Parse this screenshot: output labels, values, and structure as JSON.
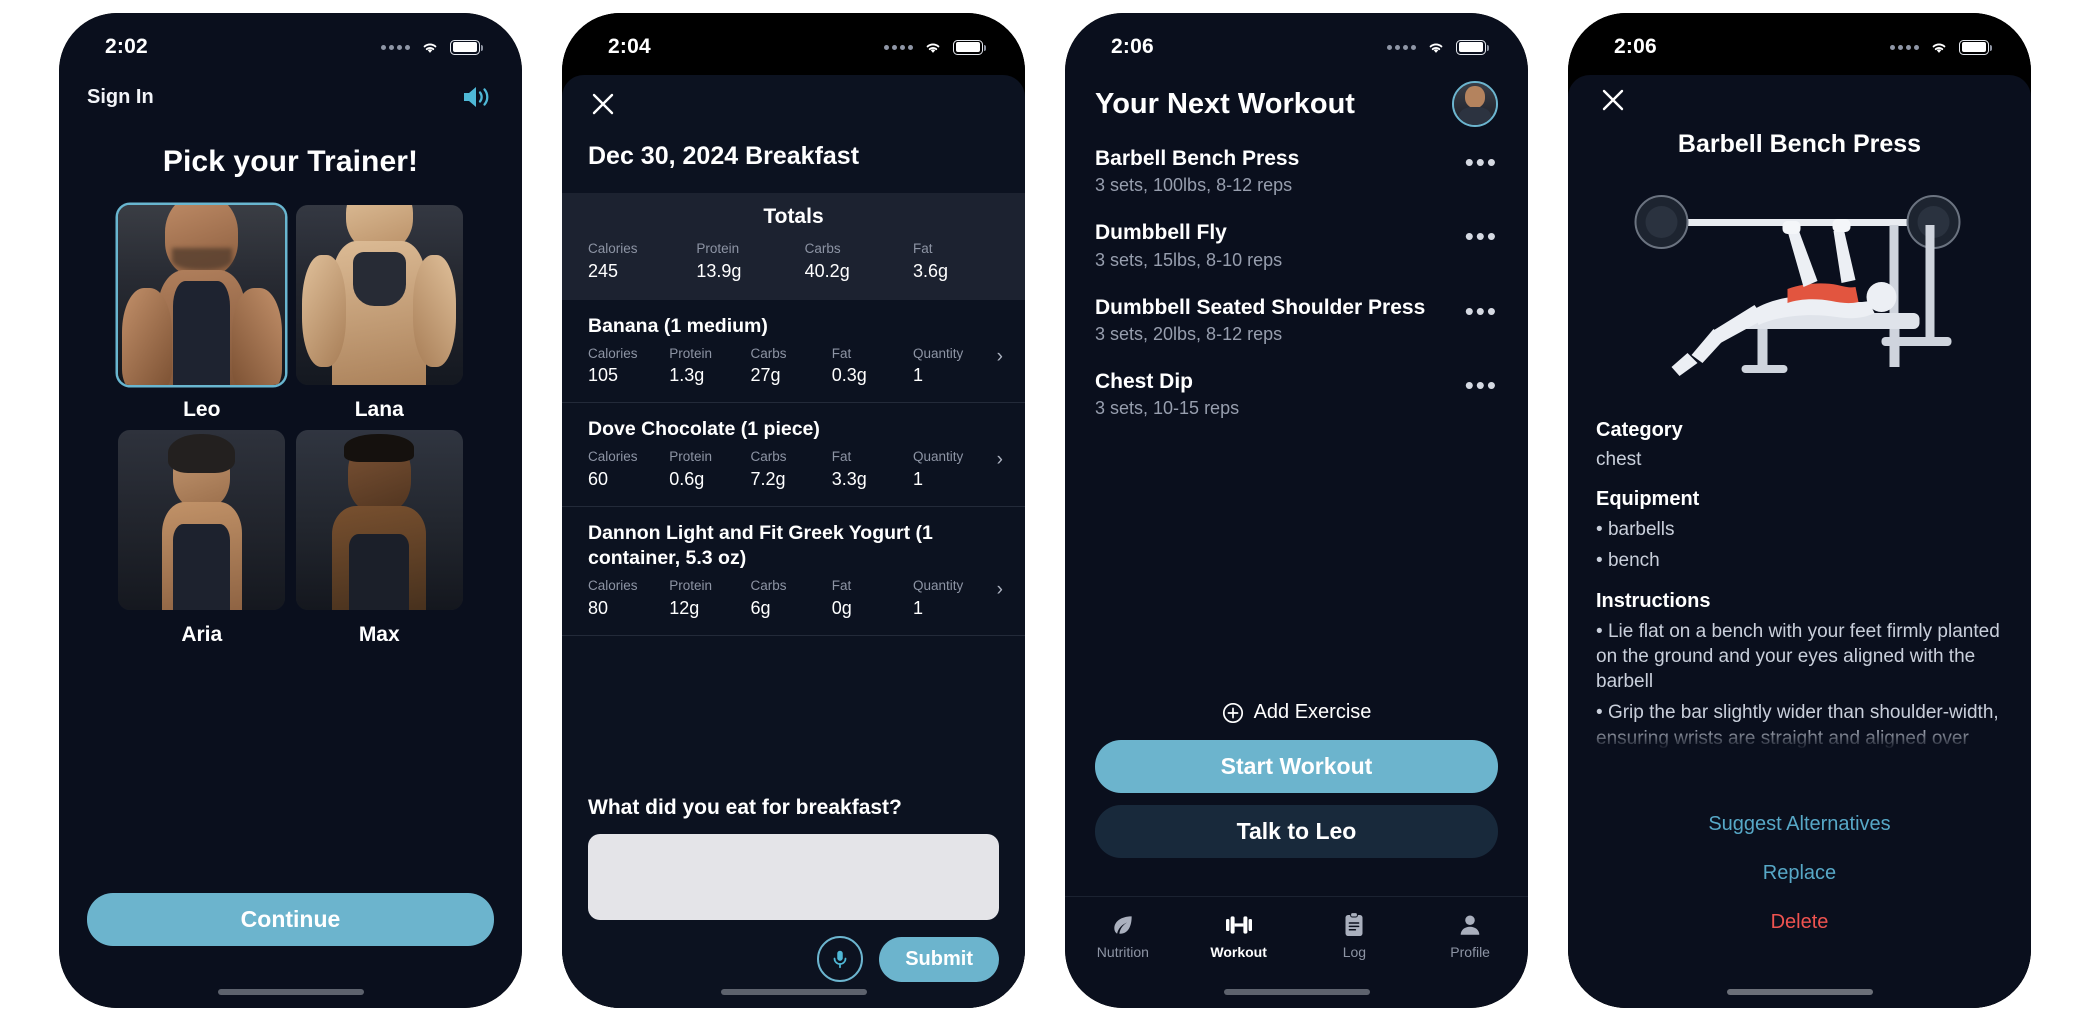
{
  "accent": "#6cb4cd",
  "danger": "#ef5350",
  "link_color": "#57a8c7",
  "phones": [
    {
      "id": "trainer-picker",
      "status": {
        "time": "2:02"
      },
      "signin_label": "Sign In",
      "speaker_icon": "speaker-wave-icon",
      "title": "Pick your Trainer!",
      "trainers": [
        {
          "name": "Leo",
          "selected": true
        },
        {
          "name": "Lana",
          "selected": false
        },
        {
          "name": "Aria",
          "selected": false
        },
        {
          "name": "Max",
          "selected": false
        }
      ],
      "continue_label": "Continue"
    },
    {
      "id": "nutrition-log",
      "status": {
        "time": "2:04"
      },
      "close_icon": "close-icon",
      "header": "Dec 30, 2024 Breakfast",
      "totals_title": "Totals",
      "macro_labels": {
        "calories": "Calories",
        "protein": "Protein",
        "carbs": "Carbs",
        "fat": "Fat",
        "quantity": "Quantity"
      },
      "totals": {
        "calories": "245",
        "protein": "13.9g",
        "carbs": "40.2g",
        "fat": "3.6g"
      },
      "foods": [
        {
          "name": "Banana (1 medium)",
          "calories": "105",
          "protein": "1.3g",
          "carbs": "27g",
          "fat": "0.3g",
          "quantity": "1"
        },
        {
          "name": "Dove Chocolate (1 piece)",
          "calories": "60",
          "protein": "0.6g",
          "carbs": "7.2g",
          "fat": "3.3g",
          "quantity": "1"
        },
        {
          "name": "Dannon Light and Fit Greek Yogurt (1 container, 5.3 oz)",
          "calories": "80",
          "protein": "12g",
          "carbs": "6g",
          "fat": "0g",
          "quantity": "1"
        }
      ],
      "prompt": "What did you eat for breakfast?",
      "input_value": "",
      "input_placeholder": "",
      "mic_icon": "microphone-icon",
      "submit_label": "Submit"
    },
    {
      "id": "next-workout",
      "status": {
        "time": "2:06"
      },
      "title": "Your Next Workout",
      "avatar_icon": "avatar",
      "exercises": [
        {
          "name": "Barbell Bench Press",
          "detail": "3 sets, 100lbs, 8-12 reps",
          "menu": "•••"
        },
        {
          "name": "Dumbbell Fly",
          "detail": "3 sets, 15lbs, 8-10 reps",
          "menu": "•••"
        },
        {
          "name": "Dumbbell Seated Shoulder Press",
          "detail": "3 sets, 20lbs, 8-12 reps",
          "menu": "•••"
        },
        {
          "name": "Chest Dip",
          "detail": "3 sets, 10-15 reps",
          "menu": "•••"
        }
      ],
      "add_exercise_label": "Add Exercise",
      "start_label": "Start Workout",
      "talk_label": "Talk to Leo",
      "tabs": [
        {
          "label": "Nutrition",
          "icon": "leaf-icon",
          "active": false
        },
        {
          "label": "Workout",
          "icon": "dumbbell-icon",
          "active": true
        },
        {
          "label": "Log",
          "icon": "clipboard-icon",
          "active": false
        },
        {
          "label": "Profile",
          "icon": "person-icon",
          "active": false
        }
      ]
    },
    {
      "id": "exercise-detail",
      "status": {
        "time": "2:06"
      },
      "close_icon": "close-icon",
      "title": "Barbell Bench Press",
      "illustration": "bench-press-illustration",
      "sections": [
        {
          "heading": "Category",
          "text": "chest"
        },
        {
          "heading": "Equipment",
          "bullets": [
            "barbells",
            "bench"
          ]
        },
        {
          "heading": "Instructions",
          "bullets": [
            "Lie flat on a bench with your feet firmly planted on the ground and your eyes aligned with the barbell",
            "Grip the bar slightly wider than shoulder-width, ensuring wrists are straight and aligned over"
          ]
        }
      ],
      "actions": [
        {
          "label": "Suggest Alternatives",
          "kind": "a"
        },
        {
          "label": "Replace",
          "kind": "b"
        },
        {
          "label": "Delete",
          "kind": "c"
        }
      ]
    }
  ]
}
